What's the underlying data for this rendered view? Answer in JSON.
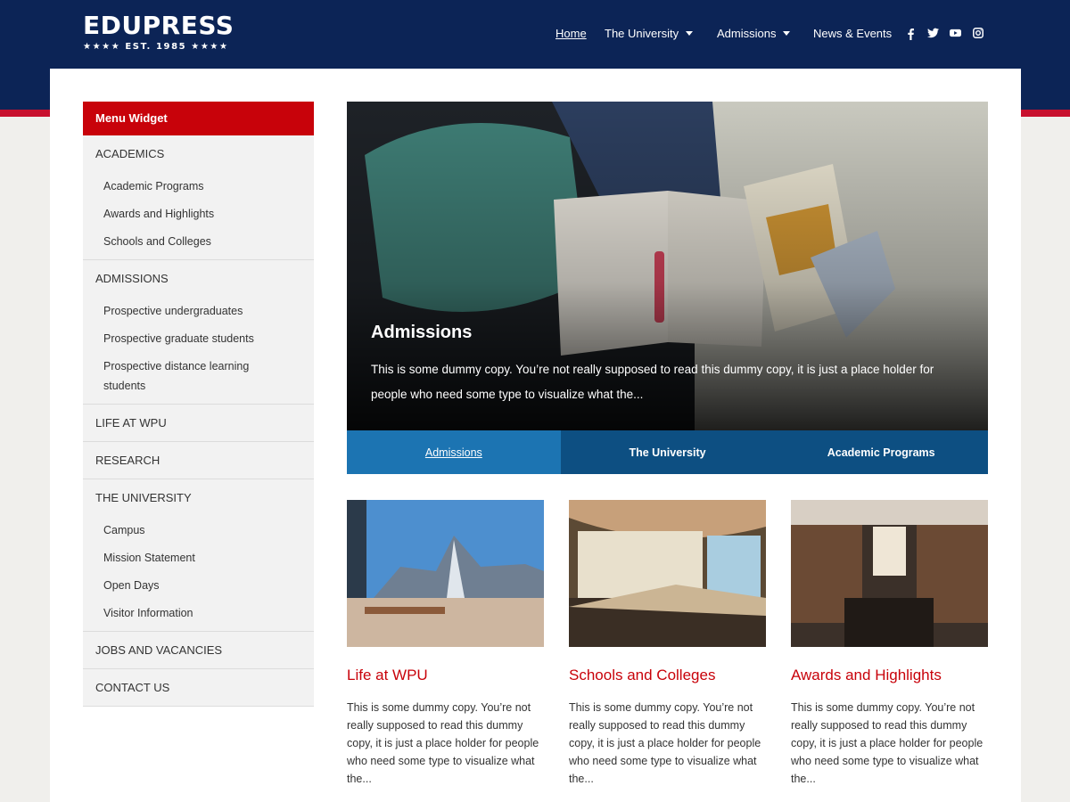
{
  "brand": {
    "name": "EDUPRESS",
    "established": "★★★★ EST. 1985 ★★★★"
  },
  "nav": {
    "items": [
      {
        "label": "Home",
        "active": true,
        "has_dropdown": false
      },
      {
        "label": "The University",
        "active": false,
        "has_dropdown": true
      },
      {
        "label": "Admissions",
        "active": false,
        "has_dropdown": true
      },
      {
        "label": "News & Events",
        "active": false,
        "has_dropdown": false
      }
    ],
    "social": [
      "facebook-icon",
      "twitter-icon",
      "youtube-icon",
      "instagram-icon"
    ]
  },
  "sidebar": {
    "title": "Menu Widget",
    "sections": [
      {
        "label": "ACADEMICS",
        "items": [
          "Academic Programs",
          "Awards and Highlights",
          "Schools and Colleges"
        ]
      },
      {
        "label": "ADMISSIONS",
        "items": [
          "Prospective undergraduates",
          "Prospective graduate students",
          "Prospective distance learning students"
        ]
      },
      {
        "label": "LIFE AT WPU",
        "items": []
      },
      {
        "label": "RESEARCH",
        "items": []
      },
      {
        "label": "THE UNIVERSITY",
        "items": [
          "Campus",
          "Mission Statement",
          "Open Days",
          "Visitor Information"
        ]
      },
      {
        "label": "JOBS AND VACANCIES",
        "items": []
      },
      {
        "label": "CONTACT US",
        "items": []
      }
    ]
  },
  "slider": {
    "title": "Admissions",
    "text": "This is some dummy copy. You’re not really supposed to read this dummy copy, it is just a place holder for people who need some type to visualize what the...",
    "tabs": [
      "Admissions",
      "The University",
      "Academic Programs"
    ],
    "active_tab": 0
  },
  "cards": [
    {
      "title": "Life at WPU",
      "text": "This is some dummy copy. You’re not really supposed to read this dummy copy, it is just a place holder for people who need some type to visualize what the..."
    },
    {
      "title": "Schools and Colleges",
      "text": "This is some dummy copy. You’re not really supposed to read this dummy copy, it is just a place holder for people who need some type to visualize what the..."
    },
    {
      "title": "Awards and Highlights",
      "text": "This is some dummy copy. You’re not really supposed to read this dummy copy, it is just a place holder for people who need some type to visualize what the..."
    }
  ],
  "colors": {
    "navy": "#0c2456",
    "red": "#c8020a",
    "tab_blue": "#0d4f82",
    "tab_active": "#1c74b2"
  }
}
